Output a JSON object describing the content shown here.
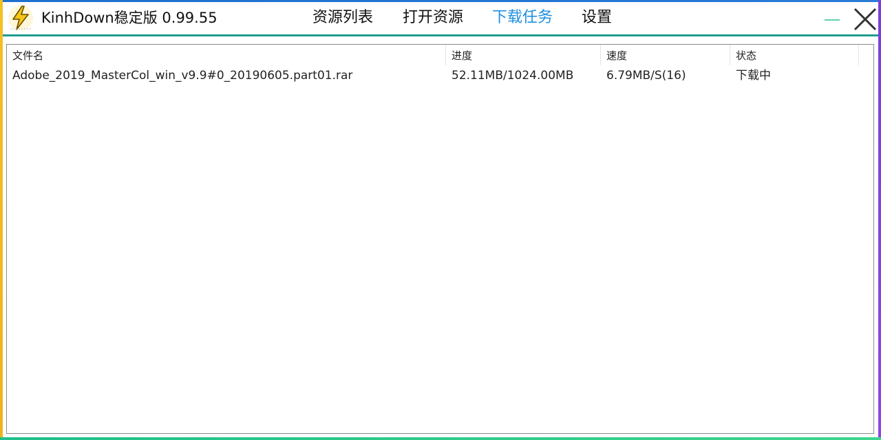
{
  "app": {
    "title": "KinhDown稳定版 0.99.55",
    "logo_icon": "lightning-bolt-icon"
  },
  "nav": {
    "items": [
      {
        "label": "资源列表",
        "active": false
      },
      {
        "label": "打开资源",
        "active": false
      },
      {
        "label": "下载任务",
        "active": true
      },
      {
        "label": "设置",
        "active": false
      }
    ]
  },
  "window_controls": {
    "minimize_icon": "minimize-icon",
    "close_icon": "close-icon"
  },
  "colors": {
    "accent_blue": "#1e8ee0",
    "title_separator": "#1f9c8f",
    "minimize_color": "#5fcfb0",
    "border_top": "#1e6fd0",
    "border_left": "#f4c020",
    "border_right": "#7d3fd8",
    "border_bottom": "#2ad08a"
  },
  "table": {
    "columns": [
      "文件名",
      "进度",
      "速度",
      "状态"
    ],
    "rows": [
      {
        "filename": "Adobe_2019_MasterCol_win_v9.9#0_20190605.part01.rar",
        "progress": "52.11MB/1024.00MB",
        "speed": "6.79MB/S(16)",
        "status": "下载中"
      }
    ]
  }
}
